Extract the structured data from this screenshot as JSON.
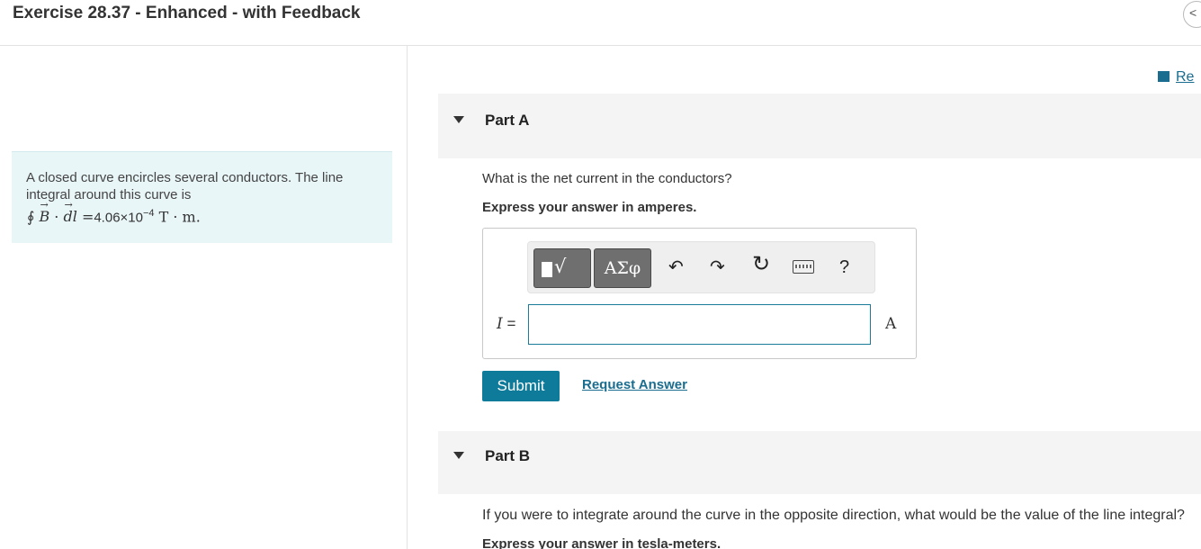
{
  "header": {
    "title": "Exercise 28.37 - Enhanced - with Feedback",
    "nav_icon": "chevron-left-icon",
    "nav_glyph": "<"
  },
  "problem": {
    "text": "A closed curve encircles several conductors. The line integral around this curve is",
    "formula": {
      "integral_symbol": "∮",
      "vector_b": "B",
      "dot": "·",
      "vector_dl": "dl",
      "equals": "=",
      "value": "4.06×10",
      "exponent": "−4",
      "units": "T · m."
    }
  },
  "resources": {
    "review_label": "Re"
  },
  "part_a": {
    "label": "Part A",
    "question": "What is the net current in the conductors?",
    "instruction": "Express your answer in amperes.",
    "toolbar": {
      "templates_icon": "templates-icon",
      "templates_glyph": "√",
      "greek_label": "ΑΣφ",
      "undo_glyph": "↶",
      "redo_glyph": "↷",
      "reset_glyph": "↻",
      "help_glyph": "?"
    },
    "variable_label": "I",
    "variable_equals": " =",
    "input_value": "",
    "unit": "A",
    "submit_label": "Submit",
    "request_label": "Request Answer"
  },
  "part_b": {
    "label": "Part B",
    "question": "If you were to integrate around the curve in the opposite direction, what would be the value of the line integral?",
    "instruction": "Express your answer in tesla-meters."
  },
  "colors": {
    "accent": "#0f7b9b",
    "link": "#1a6d8f",
    "problem_bg": "#e9f6f8",
    "part_header_bg": "#f4f4f4"
  }
}
